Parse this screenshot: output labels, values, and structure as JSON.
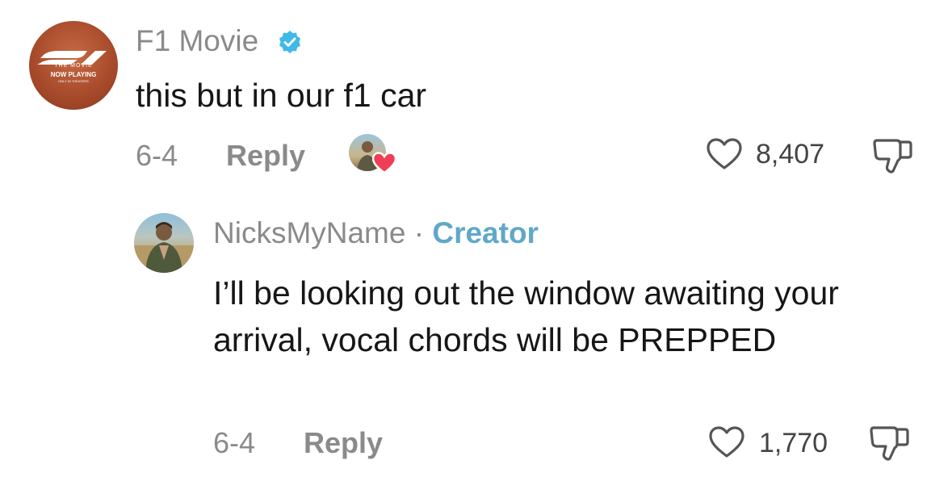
{
  "comments": [
    {
      "username": "F1 Movie",
      "verified": true,
      "avatar": {
        "icon": "f1-logo-icon",
        "line1": "THE MOVIE",
        "line2": "NOW PLAYING",
        "line3": "ONLY IN THEATERS"
      },
      "text": "this but in our f1 car",
      "date": "6-4",
      "reply_label": "Reply",
      "likes": "8,407"
    },
    {
      "username": "NicksMyName",
      "separator": "·",
      "badge": "Creator",
      "text": "I’ll be looking out the window awaiting your arrival, vocal chords will be PREPPED",
      "date": "6-4",
      "reply_label": "Reply",
      "likes": "1,770"
    }
  ],
  "colors": {
    "meta_gray": "#8a8a8a",
    "creator_blue": "#5fa8c9",
    "verified_blue": "#3fb9e8",
    "heart_red": "#ef3e55"
  }
}
